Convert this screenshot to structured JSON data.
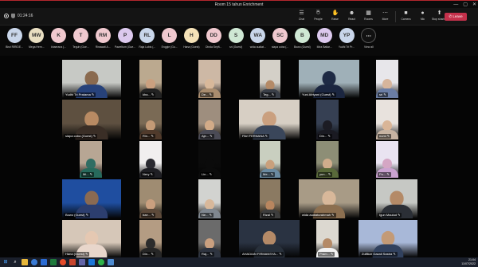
{
  "window": {
    "title": "Room 15 tahun Enrichment",
    "min": "—",
    "max": "▢",
    "close": "✕"
  },
  "toolbar": {
    "elapsed": "01:24:16",
    "tools": [
      {
        "label": "Chat",
        "icon": "chat-icon",
        "glyph": "☰"
      },
      {
        "label": "People",
        "icon": "people-icon",
        "glyph": "☺",
        "badge": "38"
      },
      {
        "label": "Raise",
        "icon": "hand-icon",
        "glyph": "✋"
      },
      {
        "label": "React",
        "icon": "smile-icon",
        "glyph": "☻"
      },
      {
        "label": "Rooms",
        "icon": "rooms-icon",
        "glyph": "▦"
      },
      {
        "label": "More",
        "icon": "more-icon",
        "glyph": "⋯"
      },
      {
        "label": "Camera",
        "icon": "camera-icon",
        "glyph": "■"
      },
      {
        "label": "Mic",
        "icon": "mic-icon",
        "glyph": "●"
      },
      {
        "label": "Stop sharing",
        "icon": "share-icon",
        "glyph": "⬆"
      }
    ],
    "leave_label": "Leave"
  },
  "participants": [
    {
      "initials": "FF",
      "name": "Bisri RIRIDE...",
      "color": "#c9d6ea"
    },
    {
      "initials": "MW",
      "name": "Mega Hern...",
      "color": "#e9dfc2"
    },
    {
      "initials": "K",
      "name": "khaerana (...",
      "color": "#f0c9cf"
    },
    {
      "initials": "T",
      "name": "Teguh (Gue...",
      "color": "#f0c9cf"
    },
    {
      "initials": "RM",
      "name": "Rinawati A...",
      "color": "#f0c9cf"
    },
    {
      "initials": "P",
      "name": "Paweltum (Gue...",
      "color": "#dcc9ee"
    },
    {
      "initials": "RL",
      "name": "Raja Lubis (...",
      "color": "#c9d6ea"
    },
    {
      "initials": "L",
      "name": "Enggie (Gu...",
      "color": "#f0c9cf"
    },
    {
      "initials": "H",
      "name": "Hana (Guest)",
      "color": "#f5e2b8"
    },
    {
      "initials": "DD",
      "name": "Dinda Seyft...",
      "color": "#f0c9cf"
    },
    {
      "initials": "S",
      "name": "sri (Guest)",
      "color": "#cfe8d4"
    },
    {
      "initials": "WA",
      "name": "wida audiat...",
      "color": "#c9d6ea"
    },
    {
      "initials": "SC",
      "name": "siapa coba (...",
      "color": "#f0c9cf"
    },
    {
      "initials": "B",
      "name": "Bowo (Guest)",
      "color": "#cfe8d4"
    },
    {
      "initials": "MD",
      "name": "Mira Batiar...",
      "color": "#dcc9ee"
    },
    {
      "initials": "YP",
      "name": "Yudhi Tri Pr...",
      "color": "#c9d6ea"
    },
    {
      "initials": "⋯",
      "name": "View all",
      "color": "#111111"
    }
  ],
  "tiles": [
    {
      "name": "Yudhi Tri Pratama",
      "bg": "#c7c9c5",
      "skin": "#8a6a4f",
      "cloth": "#27427a"
    },
    {
      "name": "kha...",
      "bg": "#bba98f",
      "skin": "#caa07f",
      "cloth": "#222"
    },
    {
      "name": "De...",
      "bg": "#cdb8a5",
      "skin": "#d8b89a",
      "cloth": "#a98c6e"
    },
    {
      "name": "Teg...",
      "bg": "#d4d0c8",
      "skin": "#b48a67",
      "cloth": "#3a3f48"
    },
    {
      "name": "Yuni Afriyani (Guest)",
      "bg": "#9fb0b8",
      "skin": "#1e2a44",
      "cloth": "#1b2640"
    },
    {
      "name": "sri",
      "bg": "#e7e6ea",
      "skin": "#d6b59c",
      "cloth": "#6b7ea5"
    },
    {
      "name": "siapa coba (Guest)",
      "bg": "#5e5040",
      "skin": "#b88a63",
      "cloth": "#3a2e26"
    },
    {
      "name": "Rin...",
      "bg": "#7a6a55",
      "skin": "#c39a76",
      "cloth": "#503a2b"
    },
    {
      "name": "Aje...",
      "bg": "#9e8e7e",
      "skin": "#d2ab88",
      "cloth": "#4a4a55"
    },
    {
      "name": "Fikri FERNANA",
      "bg": "#d7cfc4",
      "skin": "#caa07f",
      "cloth": "#3a465a"
    },
    {
      "name": "Din...",
      "bg": "#364053",
      "skin": "#1c1c24",
      "cloth": "#1a1a22"
    },
    {
      "name": "numi",
      "bg": "#e8e2dd",
      "skin": "#d9b597",
      "cloth": "#c7b3a2"
    },
    {
      "name": "Mi...",
      "bg": "#b7a694",
      "skin": "#2f6d63",
      "cloth": "#276a5c"
    },
    {
      "name": "Nery",
      "bg": "#f1efef",
      "skin": "#2a2a30",
      "cloth": "#1f1f24"
    },
    {
      "name": "Lin...",
      "bg": "#0b0b0b",
      "skin": "#0b0b0b",
      "cloth": "#0b0b0b"
    },
    {
      "name": "Me...",
      "bg": "#c9cfc0",
      "skin": "#c9a07c",
      "cloth": "#6a8aa0"
    },
    {
      "name": "yun...",
      "bg": "#8d8e76",
      "skin": "#d0ad8c",
      "cloth": "#5a6a3a"
    },
    {
      "name": "Pu...",
      "bg": "#e9e3f1",
      "skin": "#d4a6c4",
      "cloth": "#caa2d0"
    },
    {
      "name": "Bowo (Guest)",
      "bg": "#1f4ea0",
      "skin": "#8a6a52",
      "cloth": "#2c3e6f"
    },
    {
      "name": "bae...",
      "bg": "#9f8c72",
      "skin": "#caa07f",
      "cloth": "#5d4a3a"
    },
    {
      "name": "Ne...",
      "bg": "#d2d3d0",
      "skin": "#d8b89a",
      "cloth": "#7f8790"
    },
    {
      "name": "Rizal",
      "bg": "#8b7a62",
      "skin": "#b8865f",
      "cloth": "#3d3d3d"
    },
    {
      "name": "wida audiaturahmah",
      "bg": "#a89b86",
      "skin": "#d8b89a",
      "cloth": "#8c6f50"
    },
    {
      "name": "Igun Maulud",
      "bg": "#c6c8c4",
      "skin": "#b48a67",
      "cloth": "#2b2f36"
    },
    {
      "name": "Hana (Guest)",
      "bg": "#d6c7b8",
      "skin": "#e5c8b2",
      "cloth": "#e8d6cb"
    },
    {
      "name": "Din...",
      "bg": "#b49c83",
      "skin": "#2c2c2c",
      "cloth": "#262626"
    },
    {
      "name": "Raj...",
      "bg": "#6b6b6b",
      "skin": "#caa07f",
      "cloth": "#2e3440"
    },
    {
      "name": "AHADIAN FIRMANSYA...",
      "bg": "#2a3342",
      "skin": "#b48a67",
      "cloth": "#28303b"
    },
    {
      "name": "Pram...",
      "bg": "#dcd8d0",
      "skin": "#b48a67",
      "cloth": "#f2f2f2"
    },
    {
      "name": "Zulfikar Gazali Sastra",
      "bg": "#a8b8d8",
      "skin": "#c39a76",
      "cloth": "#31415e"
    }
  ],
  "taskbar": {
    "time": "21:04",
    "date": "11/07/2022"
  }
}
